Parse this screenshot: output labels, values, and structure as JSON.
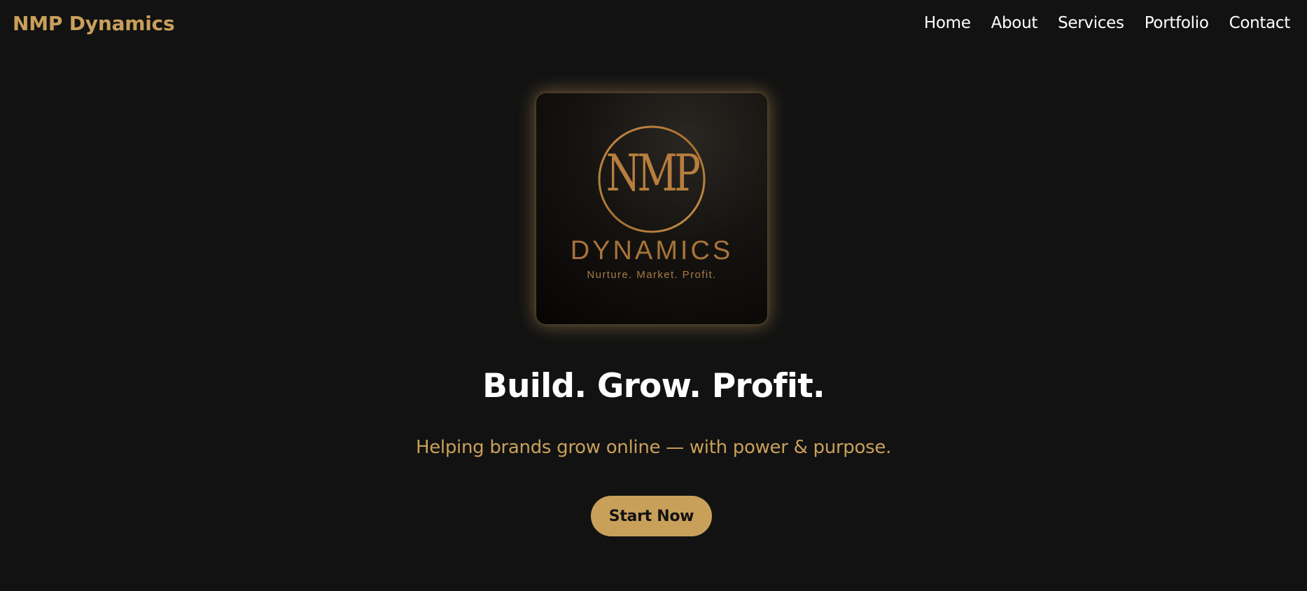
{
  "header": {
    "brand": "NMP Dynamics",
    "nav": [
      {
        "label": "Home"
      },
      {
        "label": "About"
      },
      {
        "label": "Services"
      },
      {
        "label": "Portfolio"
      },
      {
        "label": "Contact"
      }
    ]
  },
  "hero": {
    "logo": {
      "monogram": "NMP",
      "wordmark": "DYNAMICS",
      "tagline": "Nurture. Market. Profit."
    },
    "title": "Build. Grow. Profit.",
    "subtitle": "Helping brands grow online — with power & purpose.",
    "cta_label": "Start Now"
  },
  "colors": {
    "background": "#121212",
    "accent_gold": "#c9a05a",
    "logo_bronze": "#b77e3e",
    "text_primary": "#ffffff"
  }
}
